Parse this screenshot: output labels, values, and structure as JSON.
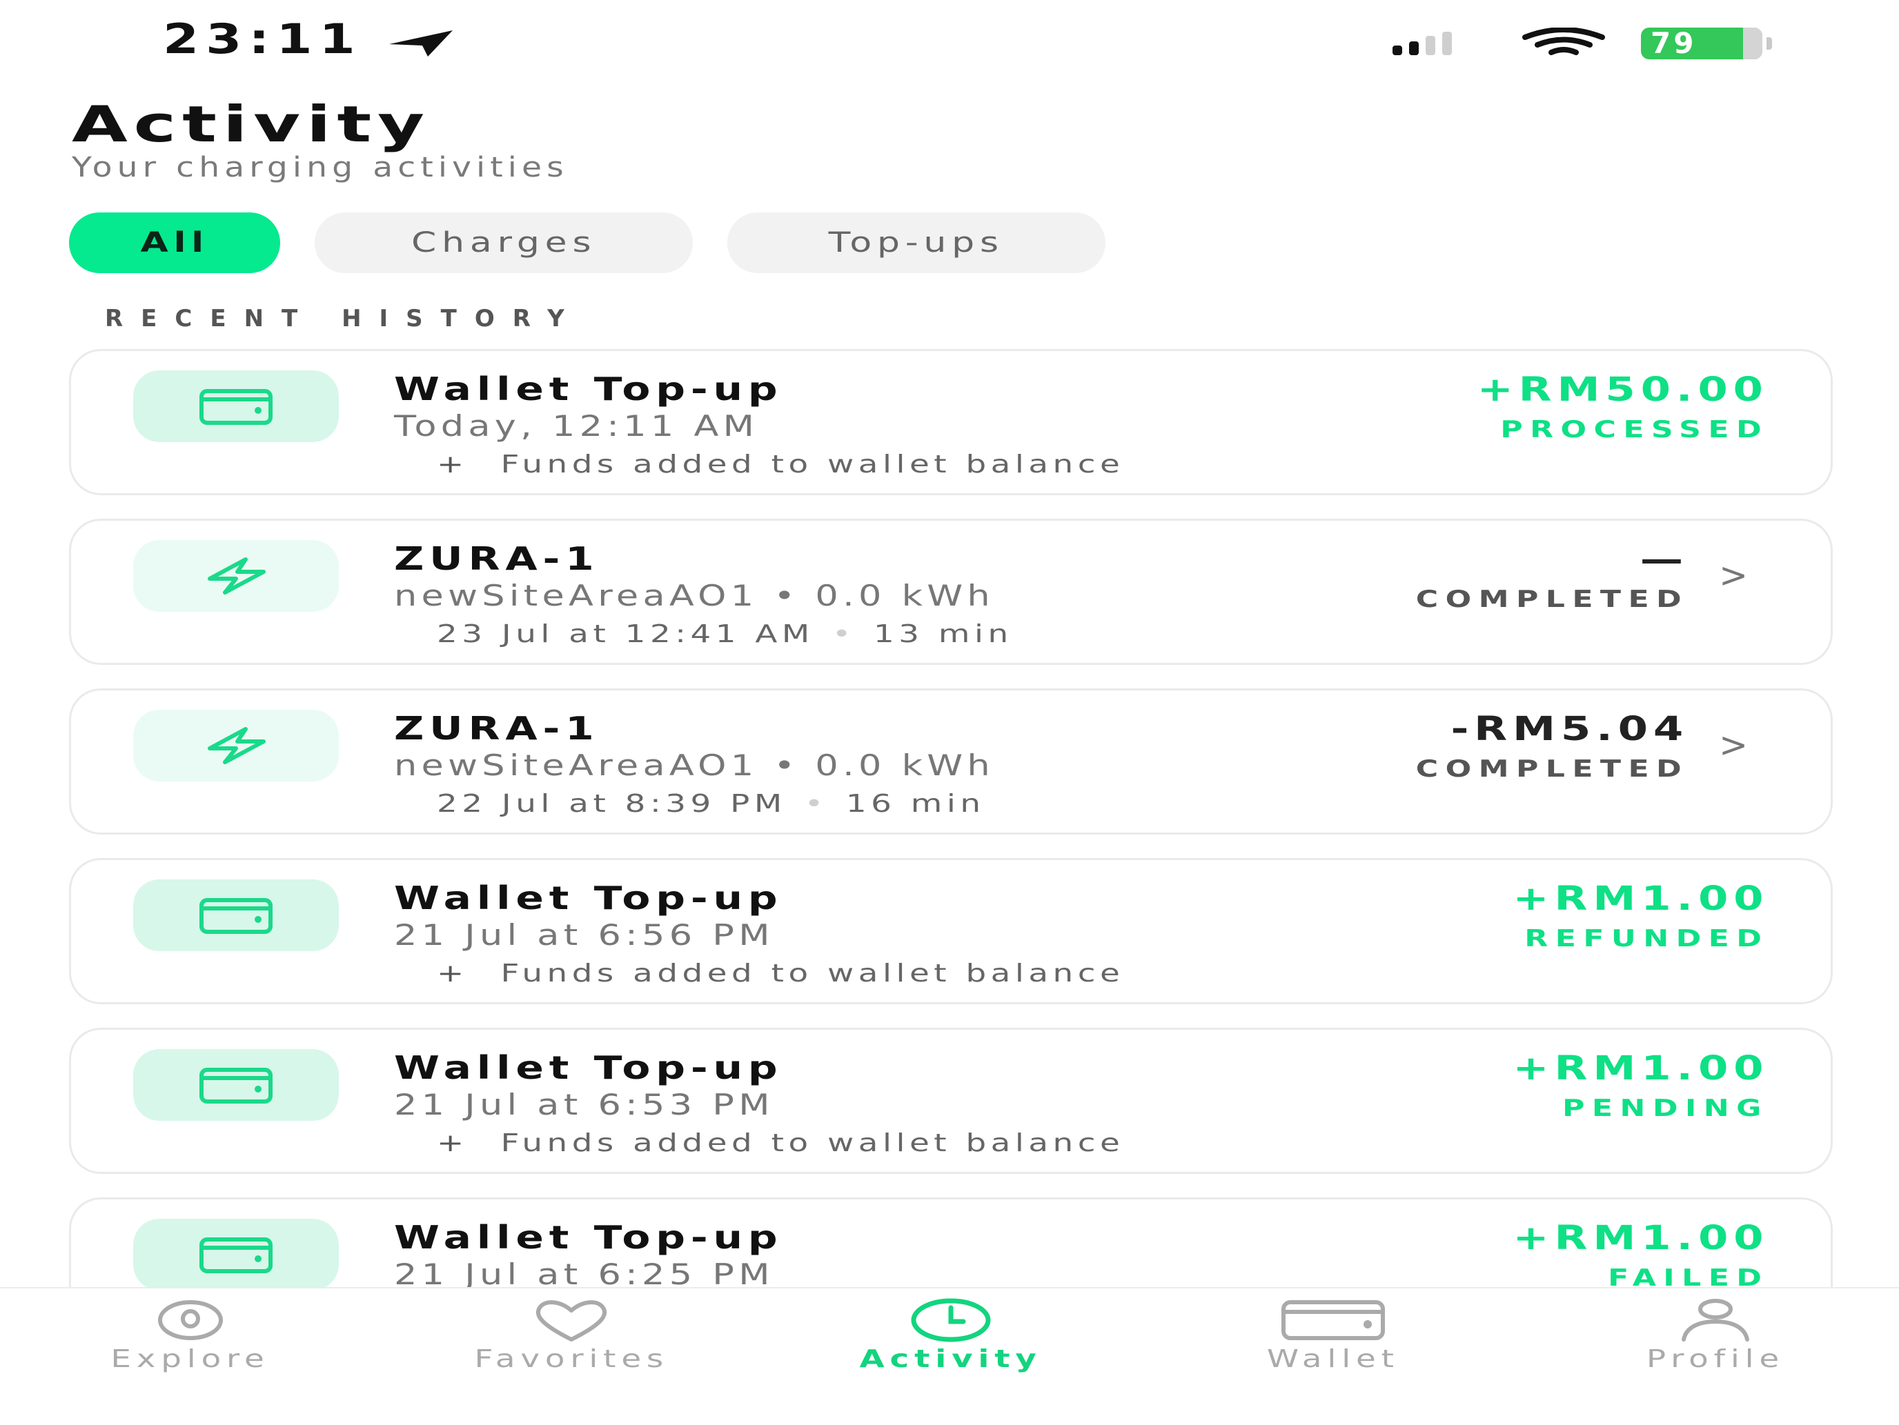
{
  "status_bar": {
    "time": "23:11",
    "battery": "79"
  },
  "header": {
    "title": "Activity",
    "subtitle": "Your charging activities"
  },
  "filters": [
    {
      "label": "All",
      "active": true
    },
    {
      "label": "Charges",
      "active": false
    },
    {
      "label": "Top-ups",
      "active": false
    }
  ],
  "section_heading": "RECENT HISTORY",
  "activities": [
    {
      "type": "topup",
      "title": "Wallet Top-up",
      "date": "Today, 12:11 AM",
      "note": "Funds added to wallet balance",
      "amount": "+RM50.00",
      "status": "PROCESSED"
    },
    {
      "type": "charge",
      "title": "ZURA-1",
      "details": "newSiteAreaAO1 • 0.0 kWh",
      "date": "23 Jul at 12:41 AM",
      "duration": "13 min",
      "amount": "—",
      "status": "COMPLETED"
    },
    {
      "type": "charge",
      "title": "ZURA-1",
      "details": "newSiteAreaAO1 • 0.0 kWh",
      "date": "22 Jul at 8:39 PM",
      "duration": "16 min",
      "amount": "-RM5.04",
      "status": "COMPLETED"
    },
    {
      "type": "topup",
      "title": "Wallet Top-up",
      "date": "21 Jul at 6:56 PM",
      "note": "Funds added to wallet balance",
      "amount": "+RM1.00",
      "status": "REFUNDED"
    },
    {
      "type": "topup",
      "title": "Wallet Top-up",
      "date": "21 Jul at 6:53 PM",
      "note": "Funds added to wallet balance",
      "amount": "+RM1.00",
      "status": "PENDING"
    },
    {
      "type": "topup",
      "title": "Wallet Top-up",
      "date": "21 Jul at 6:25 PM",
      "amount": "+RM1.00",
      "status": "FAILED"
    }
  ],
  "tab_bar": [
    {
      "label": "Explore",
      "icon": "map-pin-icon",
      "active": false
    },
    {
      "label": "Favorites",
      "icon": "heart-icon",
      "active": false
    },
    {
      "label": "Activity",
      "icon": "clock-icon",
      "active": true
    },
    {
      "label": "Wallet",
      "icon": "wallet-icon",
      "active": false
    },
    {
      "label": "Profile",
      "icon": "person-icon",
      "active": false
    }
  ],
  "colors": {
    "accent": "#05e98f",
    "accent_text": "#0ee085",
    "badge_bg": "#d7f7ea"
  }
}
